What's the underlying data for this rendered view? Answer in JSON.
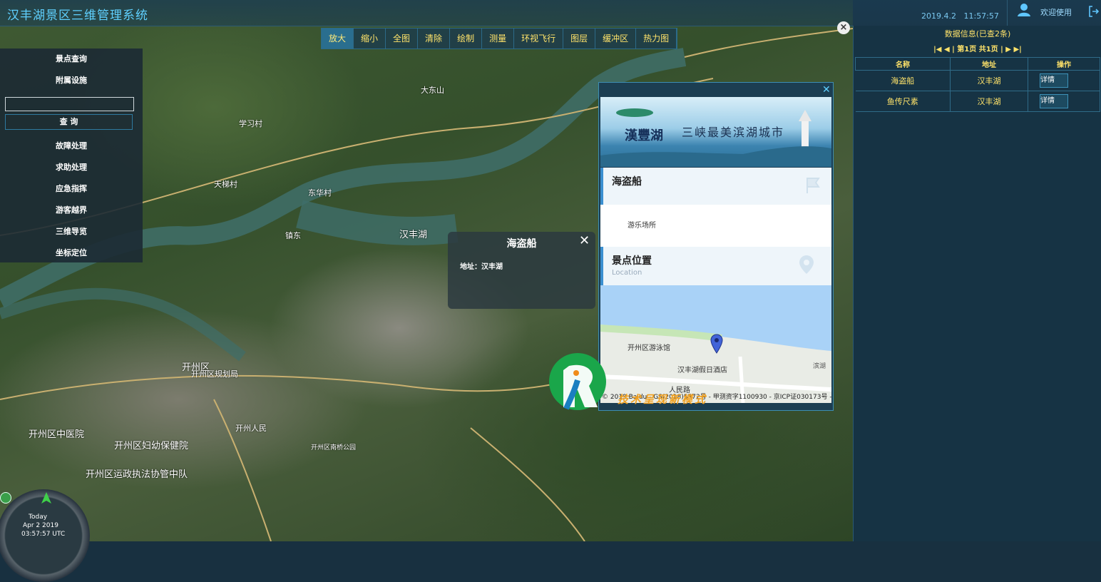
{
  "header": {
    "app_title": "汉丰湖景区三维管理系统",
    "date": "2019.4.2",
    "time": "11:57:57",
    "welcome": "欢迎使用"
  },
  "toolbar": {
    "buttons": [
      "放大",
      "缩小",
      "全图",
      "清除",
      "绘制",
      "测量",
      "环视飞行",
      "图层",
      "缓冲区",
      "热力图"
    ],
    "active": "放大"
  },
  "left_menu": {
    "items_top": [
      "景点查询",
      "附属设施"
    ],
    "search_placeholder": "",
    "search_button": "查 询",
    "items_bottom": [
      "故障处理",
      "求助处理",
      "应急指挥",
      "游客越界",
      "三维导览",
      "坐标定位"
    ]
  },
  "data_panel": {
    "title": "数据信息(已查2条)",
    "pager": "|◀ ◀ | 第1页 共1页 | ▶ ▶|",
    "columns": [
      "名称",
      "地址",
      "操作"
    ],
    "rows": [
      {
        "name": "海盗船",
        "address": "汉丰湖",
        "action": "详情"
      },
      {
        "name": "鱼传尺素",
        "address": "汉丰湖",
        "action": "详情"
      }
    ]
  },
  "popup": {
    "title": "海盗船",
    "close": "✕",
    "address": "地址：汉丰湖"
  },
  "detail": {
    "close": "✕",
    "banner_brand": "漢豐湖",
    "banner_slogan": "三峡最美滨湖城市",
    "name_heading": "海盗船",
    "description": "游乐场所",
    "location_heading": "景点位置",
    "location_sub": "Location",
    "map_copyright": "© 2019 Baidu - GS(2018)5572号 - 甲测资字1100930 - 京ICP证030173号 -",
    "map_labels": [
      "开州区游泳馆",
      "汉丰湖假日酒店",
      "人民路",
      "滨湖"
    ]
  },
  "map_labels": [
    "大东山",
    "学习村",
    "天梯村",
    "东华村",
    "汉丰湖",
    "开州区",
    "镇东",
    "开州区规划局",
    "开州区中医院",
    "开州区妇幼保健院",
    "开州区运政执法协管中队",
    "开州人民",
    "开州区南桥公园"
  ],
  "watermark": "技术呈现新模式",
  "compass": {
    "today": "Today",
    "date": "Apr 2 2019",
    "utc": "03:57:57 UTC"
  }
}
